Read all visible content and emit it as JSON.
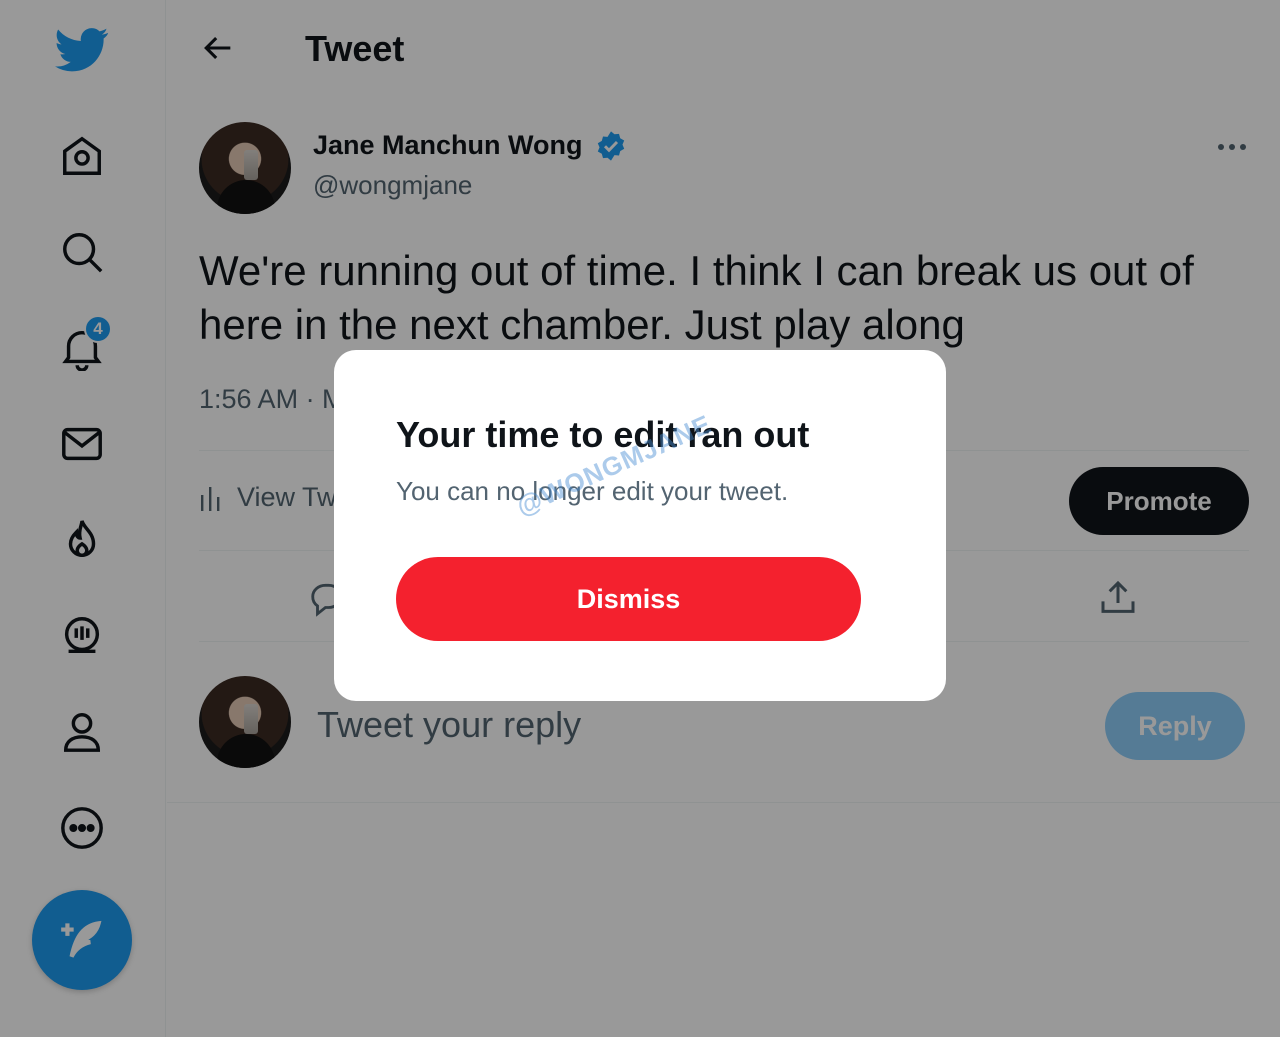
{
  "sidebar": {
    "logo_icon": "twitter-bird-icon",
    "items": [
      {
        "icon": "home-icon"
      },
      {
        "icon": "search-icon"
      },
      {
        "icon": "bell-icon",
        "badge": "4"
      },
      {
        "icon": "envelope-icon"
      },
      {
        "icon": "flame-icon"
      },
      {
        "icon": "spaces-icon"
      },
      {
        "icon": "person-icon"
      },
      {
        "icon": "more-circle-icon"
      }
    ],
    "compose_icon": "feather-plus-icon",
    "brand_color": "#1d9bf0"
  },
  "header": {
    "title": "Tweet"
  },
  "tweet": {
    "author_name": "Jane Manchun Wong",
    "author_handle": "@wongmjane",
    "text": "We're running out of time. I think I can break us out of here in the next chamber. Just play along",
    "meta": "1:56 AM · M",
    "analytics_label": "View Tw",
    "promote_label": "Promote"
  },
  "reply": {
    "placeholder": "Tweet your reply",
    "button_label": "Reply"
  },
  "modal": {
    "title": "Your time to edit ran out",
    "body": "You can no longer edit your tweet.",
    "watermark": "@WONGMJANE",
    "dismiss_label": "Dismiss",
    "dismiss_color": "#f4212e"
  }
}
